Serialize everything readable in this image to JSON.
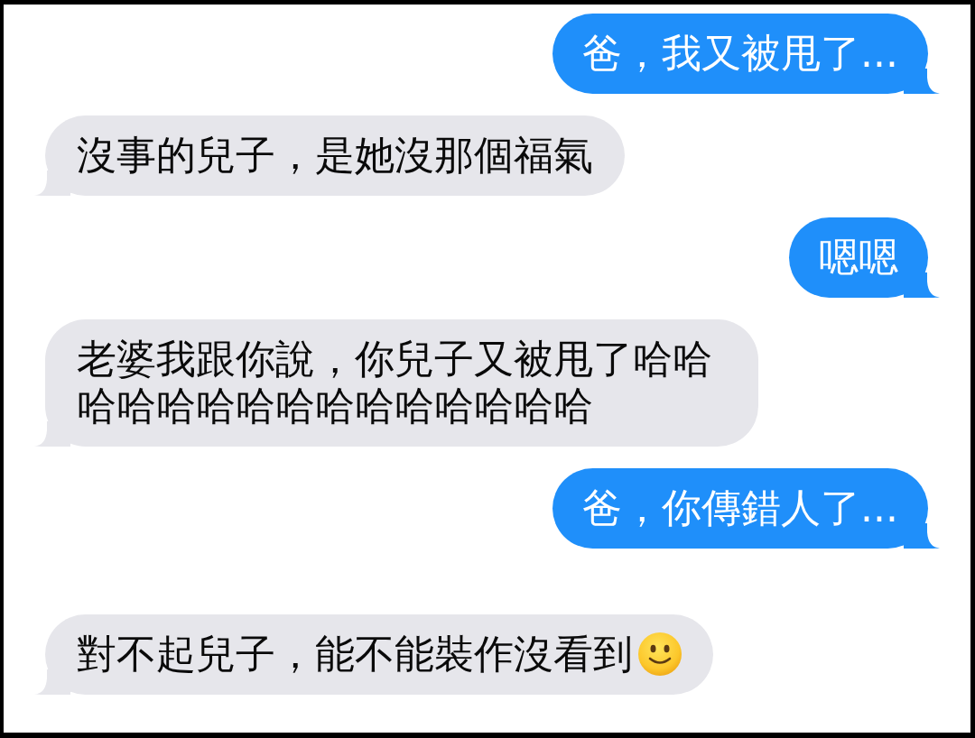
{
  "messages": [
    {
      "outgoing": true,
      "text": "爸，我又被甩了..."
    },
    {
      "outgoing": false,
      "text": "沒事的兒子，是她沒那個福氣"
    },
    {
      "outgoing": true,
      "text": "嗯嗯"
    },
    {
      "outgoing": false,
      "text": "老婆我跟你說，你兒子又被甩了哈哈哈哈哈哈哈哈哈哈哈哈哈哈哈"
    },
    {
      "outgoing": true,
      "text": "爸，你傳錯人了..."
    },
    {
      "outgoing": false,
      "text": "對不起兒子，能不能裝作沒看到",
      "trailing_emoji": true
    }
  ]
}
